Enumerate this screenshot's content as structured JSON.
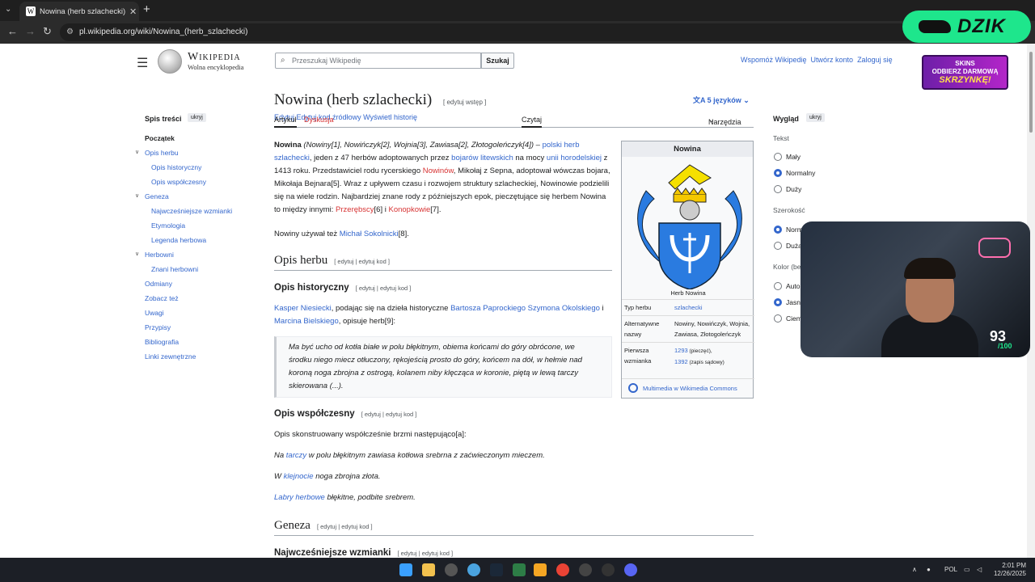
{
  "browser": {
    "tab_title": "Nowina (herb szlachecki) – Wiki",
    "tab_close": "✕",
    "new_tab": "+",
    "url": "pl.wikipedia.org/wiki/Nowina_(herb_szlachecki)"
  },
  "header": {
    "wordmark": "Wikipedia",
    "tagline": "Wolna encyklopedia",
    "search_placeholder": "Przeszukaj Wikipedię",
    "search_button": "Szukaj",
    "user_links": [
      "Wspomóż Wikipedię",
      "Utwórz konto",
      "Zaloguj się"
    ]
  },
  "toc": {
    "title": "Spis treści",
    "hide": "ukryj",
    "items": [
      {
        "label": "Początek"
      },
      {
        "label": "Opis herbu"
      },
      {
        "label": "Opis historyczny"
      },
      {
        "label": "Opis współczesny"
      },
      {
        "label": "Geneza"
      },
      {
        "label": "Najwcześniejsze wzmianki"
      },
      {
        "label": "Etymologia"
      },
      {
        "label": "Legenda herbowa"
      },
      {
        "label": "Herbowni"
      },
      {
        "label": "Znani herbowni"
      },
      {
        "label": "Odmiany"
      },
      {
        "label": "Zobacz też"
      },
      {
        "label": "Uwagi"
      },
      {
        "label": "Przypisy"
      },
      {
        "label": "Bibliografia"
      },
      {
        "label": "Linki zewnętrzne"
      }
    ]
  },
  "article": {
    "title": "Nowina (herb szlachecki)",
    "edit_intro": "[ edytuj wstęp ]",
    "languages": "5 języków",
    "tabs_left": [
      "Artykuł",
      "Dyskusja"
    ],
    "tabs_right": [
      "Czytaj",
      "Edytuj",
      "Edytuj kod źródłowy",
      "Wyświetl historię",
      "Narzędzia"
    ],
    "intro": {
      "name": "Nowina",
      "variants": "(Nowiny[1], Nowińczyk[2], Wojnia[3], Zawiasa[2], Złotogoleńczyk[4])",
      "dash": " – ",
      "link1": "polski herb szlachecki",
      "t1": ", jeden z 47 herbów adoptowanych przez ",
      "link2": "bojarów litewskich",
      "t2": " na mocy ",
      "link3": "unii horodelskiej",
      "t3": " z 1413 roku. Przedstawiciel rodu rycerskiego ",
      "link4": "Nowinów",
      "t4": ", Mikołaj z Sepna, adoptował wówczas bojara, Mikołaja Bejnara[5]. Wraz z upływem czasu i rozwojem struktury szlacheckiej, Nowinowie podzielili się na wiele rodzin. Najbardziej znane rody z późniejszych epok, pieczętujące się herbem Nowina to między innymi: ",
      "link5": "Przerębscy",
      "t5": "[6] i ",
      "link6": "Konopkowie",
      "t6": "[7]."
    },
    "p2_text": "Nowiny używał też ",
    "p2_link": "Michał Sokolnicki",
    "p2_ref": "[8].",
    "h2_opis": "Opis herbu",
    "edit_links": "[ edytuj | edytuj kod ]",
    "h3_hist": "Opis historyczny",
    "hist_p": {
      "link1": "Kasper Niesiecki",
      "t1": ", podając się na dzieła historyczne ",
      "link2": "Bartosza Paprockiego Szymona Okolskiego",
      "t2": " i ",
      "link3": "Marcina Bielskiego",
      "t3": ", opisuje herb[9]:"
    },
    "quote": "Ma być ucho od kotła białe w polu błękitnym, obiema końcami do góry obrócone, we środku niego miecz otłuczony, rękojeścią prosto do góry, końcem na dół, w hełmie nad koroną noga zbrojna z ostrogą, kolanem niby klęcząca w koronie, piętą w lewą tarczy skierowana (...).",
    "h3_wspol": "Opis współczesny",
    "wspol_p1": "Opis skonstruowany współcześnie brzmi następująco[a]:",
    "wspol_p2_a": "Na ",
    "wspol_p2_link": "tarczy",
    "wspol_p2_b": " w polu błękitnym zawiasa kotłowa srebrna z zaćwieczonym mieczem.",
    "wspol_p3_a": "W ",
    "wspol_p3_link": "klejnocie",
    "wspol_p3_b": " noga zbrojna złota.",
    "wspol_p4_link": "Labry herbowe",
    "wspol_p4_b": " błękitne, podbite srebrem.",
    "h2_geneza": "Geneza",
    "h3_najw": "Najwcześniejsze wzmianki"
  },
  "infobox": {
    "title": "Nowina",
    "caption": "Herb Nowina",
    "rows": [
      {
        "k": "Typ herbu",
        "v": "szlachecki"
      },
      {
        "k": "Alternatywne nazwy",
        "v": "Nowiny, Nowińczyk, Wojnia, Zawiasa, Złotogoleńczyk"
      },
      {
        "k": "Pierwsza wzmianka",
        "v1": "1293",
        "v1s": " (pieczęć),",
        "v2": "1392",
        "v2s": " (zapis sądowy)"
      }
    ],
    "commons": "Multimedia w Wikimedia Commons"
  },
  "appearance": {
    "title": "Wygląd",
    "hide": "ukryj",
    "text_label": "Tekst",
    "text_opts": [
      "Mały",
      "Normalny",
      "Duży"
    ],
    "width_label": "Szerokość",
    "width_opts": [
      "Normalna",
      "Duża"
    ],
    "color_label": "Kolor (beta)",
    "color_opts": [
      "Automatyczny",
      "Jasny",
      "Ciemny"
    ]
  },
  "overlay": {
    "brand": "DZIK",
    "promo_top": "SKINS",
    "promo_mid": "ODBIERZ DARMOWĄ",
    "promo_big": "SKRZYNKĘ!",
    "score": "93",
    "score_max": "/100"
  },
  "taskbar": {
    "lang": "POL",
    "time": "2:01 PM",
    "date": "12/26/2025"
  },
  "colors": {
    "link": "#3366cc",
    "redlink": "#d73333",
    "brand": "#1ee68c"
  }
}
